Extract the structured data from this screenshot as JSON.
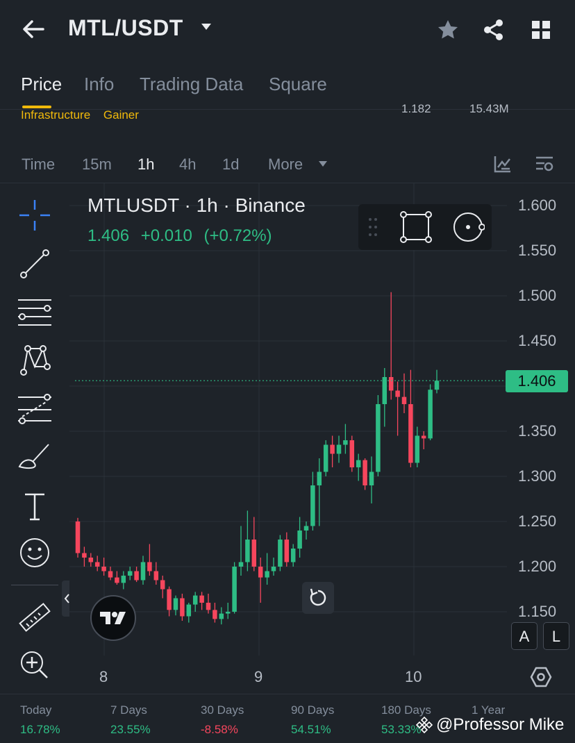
{
  "header": {
    "pair": "MTL/USDT",
    "icons": [
      "back-arrow-icon",
      "caret-down-icon",
      "star-icon",
      "share-icon",
      "grid-icon"
    ]
  },
  "tabs": [
    {
      "label": "Price",
      "active": true
    },
    {
      "label": "Info"
    },
    {
      "label": "Trading Data"
    },
    {
      "label": "Square"
    }
  ],
  "tags": [
    "Infrastructure",
    "Gainer"
  ],
  "partial_stats": {
    "left": "1.182",
    "right": "15.43M"
  },
  "timeframes": [
    {
      "label": "Time"
    },
    {
      "label": "15m"
    },
    {
      "label": "1h",
      "active": true
    },
    {
      "label": "4h"
    },
    {
      "label": "1d"
    },
    {
      "label": "More"
    }
  ],
  "chart_header": {
    "title": "MTLUSDT · 1h · Binance",
    "price": "1.406",
    "change": "+0.010",
    "change_pct": "(+0.72%)"
  },
  "price_tag": "1.406",
  "scale_buttons": {
    "auto": "A",
    "log": "L"
  },
  "colors": {
    "up": "#2ebd85",
    "down": "#f6465d",
    "accent": "#f0b90b",
    "background": "#1e2329"
  },
  "chart_data": {
    "type": "candlestick",
    "y_ticks": [
      "1.600",
      "1.550",
      "1.500",
      "1.450",
      "1.350",
      "1.300",
      "1.250",
      "1.200",
      "1.150"
    ],
    "x_ticks": [
      "8",
      "9",
      "10"
    ],
    "ylim": [
      1.15,
      1.6
    ],
    "current_price": 1.406,
    "candles": [
      {
        "o": 1.25,
        "h": 1.254,
        "l": 1.21,
        "c": 1.215
      },
      {
        "o": 1.215,
        "h": 1.222,
        "l": 1.2,
        "c": 1.21
      },
      {
        "o": 1.21,
        "h": 1.215,
        "l": 1.2,
        "c": 1.205
      },
      {
        "o": 1.205,
        "h": 1.212,
        "l": 1.195,
        "c": 1.2
      },
      {
        "o": 1.2,
        "h": 1.21,
        "l": 1.19,
        "c": 1.195
      },
      {
        "o": 1.195,
        "h": 1.2,
        "l": 1.185,
        "c": 1.188
      },
      {
        "o": 1.188,
        "h": 1.195,
        "l": 1.18,
        "c": 1.182
      },
      {
        "o": 1.182,
        "h": 1.195,
        "l": 1.175,
        "c": 1.19
      },
      {
        "o": 1.19,
        "h": 1.2,
        "l": 1.185,
        "c": 1.195
      },
      {
        "o": 1.195,
        "h": 1.2,
        "l": 1.183,
        "c": 1.185
      },
      {
        "o": 1.185,
        "h": 1.212,
        "l": 1.18,
        "c": 1.205
      },
      {
        "o": 1.205,
        "h": 1.225,
        "l": 1.19,
        "c": 1.195
      },
      {
        "o": 1.195,
        "h": 1.205,
        "l": 1.18,
        "c": 1.185
      },
      {
        "o": 1.185,
        "h": 1.19,
        "l": 1.165,
        "c": 1.175
      },
      {
        "o": 1.175,
        "h": 1.178,
        "l": 1.145,
        "c": 1.152
      },
      {
        "o": 1.152,
        "h": 1.168,
        "l": 1.146,
        "c": 1.165
      },
      {
        "o": 1.165,
        "h": 1.17,
        "l": 1.14,
        "c": 1.145
      },
      {
        "o": 1.145,
        "h": 1.16,
        "l": 1.138,
        "c": 1.158
      },
      {
        "o": 1.158,
        "h": 1.172,
        "l": 1.15,
        "c": 1.168
      },
      {
        "o": 1.168,
        "h": 1.172,
        "l": 1.152,
        "c": 1.16
      },
      {
        "o": 1.16,
        "h": 1.17,
        "l": 1.148,
        "c": 1.152
      },
      {
        "o": 1.152,
        "h": 1.16,
        "l": 1.138,
        "c": 1.142
      },
      {
        "o": 1.142,
        "h": 1.155,
        "l": 1.136,
        "c": 1.148
      },
      {
        "o": 1.148,
        "h": 1.16,
        "l": 1.142,
        "c": 1.15
      },
      {
        "o": 1.15,
        "h": 1.205,
        "l": 1.148,
        "c": 1.2
      },
      {
        "o": 1.2,
        "h": 1.245,
        "l": 1.19,
        "c": 1.205
      },
      {
        "o": 1.205,
        "h": 1.262,
        "l": 1.195,
        "c": 1.23
      },
      {
        "o": 1.23,
        "h": 1.255,
        "l": 1.195,
        "c": 1.2
      },
      {
        "o": 1.2,
        "h": 1.21,
        "l": 1.16,
        "c": 1.188
      },
      {
        "o": 1.188,
        "h": 1.215,
        "l": 1.18,
        "c": 1.195
      },
      {
        "o": 1.195,
        "h": 1.21,
        "l": 1.19,
        "c": 1.2
      },
      {
        "o": 1.2,
        "h": 1.235,
        "l": 1.195,
        "c": 1.23
      },
      {
        "o": 1.23,
        "h": 1.238,
        "l": 1.2,
        "c": 1.205
      },
      {
        "o": 1.205,
        "h": 1.225,
        "l": 1.2,
        "c": 1.22
      },
      {
        "o": 1.22,
        "h": 1.255,
        "l": 1.21,
        "c": 1.24
      },
      {
        "o": 1.24,
        "h": 1.25,
        "l": 1.23,
        "c": 1.245
      },
      {
        "o": 1.245,
        "h": 1.305,
        "l": 1.24,
        "c": 1.29
      },
      {
        "o": 1.29,
        "h": 1.32,
        "l": 1.245,
        "c": 1.305
      },
      {
        "o": 1.305,
        "h": 1.34,
        "l": 1.3,
        "c": 1.335
      },
      {
        "o": 1.335,
        "h": 1.345,
        "l": 1.31,
        "c": 1.325
      },
      {
        "o": 1.325,
        "h": 1.345,
        "l": 1.315,
        "c": 1.335
      },
      {
        "o": 1.335,
        "h": 1.358,
        "l": 1.325,
        "c": 1.34
      },
      {
        "o": 1.34,
        "h": 1.345,
        "l": 1.305,
        "c": 1.31
      },
      {
        "o": 1.31,
        "h": 1.325,
        "l": 1.295,
        "c": 1.318
      },
      {
        "o": 1.318,
        "h": 1.32,
        "l": 1.285,
        "c": 1.29
      },
      {
        "o": 1.29,
        "h": 1.322,
        "l": 1.27,
        "c": 1.305
      },
      {
        "o": 1.305,
        "h": 1.39,
        "l": 1.3,
        "c": 1.38
      },
      {
        "o": 1.38,
        "h": 1.42,
        "l": 1.355,
        "c": 1.41
      },
      {
        "o": 1.41,
        "h": 1.504,
        "l": 1.385,
        "c": 1.395
      },
      {
        "o": 1.395,
        "h": 1.405,
        "l": 1.345,
        "c": 1.388
      },
      {
        "o": 1.388,
        "h": 1.414,
        "l": 1.37,
        "c": 1.38
      },
      {
        "o": 1.38,
        "h": 1.418,
        "l": 1.31,
        "c": 1.315
      },
      {
        "o": 1.315,
        "h": 1.355,
        "l": 1.31,
        "c": 1.345
      },
      {
        "o": 1.345,
        "h": 1.35,
        "l": 1.33,
        "c": 1.342
      },
      {
        "o": 1.342,
        "h": 1.402,
        "l": 1.34,
        "c": 1.396
      },
      {
        "o": 1.396,
        "h": 1.418,
        "l": 1.392,
        "c": 1.406
      }
    ]
  },
  "performance": [
    {
      "period": "Today",
      "value": "16.78%",
      "dir": "up"
    },
    {
      "period": "7 Days",
      "value": "23.55%",
      "dir": "up"
    },
    {
      "period": "30 Days",
      "value": "-8.58%",
      "dir": "down"
    },
    {
      "period": "90 Days",
      "value": "54.51%",
      "dir": "up"
    },
    {
      "period": "180 Days",
      "value": "53.33%",
      "dir": "up"
    },
    {
      "period": "1 Year",
      "value": "",
      "dir": "down"
    }
  ],
  "watermark": "@Professor Mike"
}
